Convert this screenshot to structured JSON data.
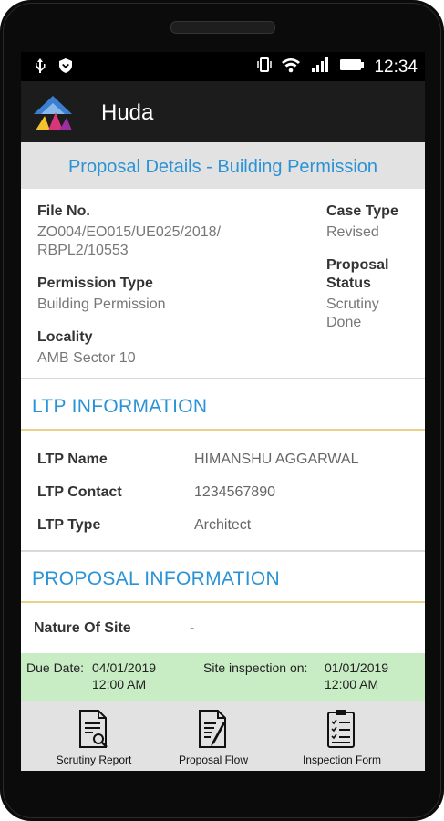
{
  "status_bar": {
    "time": "12:34"
  },
  "app": {
    "title": "Huda"
  },
  "page_title": "Proposal Details - Building Permission",
  "details": {
    "file_no_label": "File No.",
    "file_no_line1": "ZO004/EO015/UE025/2018/",
    "file_no_line2": "RBPL2/10553",
    "case_type_label": "Case Type",
    "case_type_value": "Revised",
    "permission_type_label": "Permission Type",
    "permission_type_value": "Building Permission",
    "proposal_status_label_line1": "Proposal",
    "proposal_status_label_line2": "Status",
    "proposal_status_line1": "Scrutiny",
    "proposal_status_line2": "Done",
    "locality_label": "Locality",
    "locality_value": "AMB Sector 10"
  },
  "ltp": {
    "heading": "LTP INFORMATION",
    "name_label": "LTP Name",
    "name_value": "HIMANSHU AGGARWAL",
    "contact_label": "LTP Contact",
    "contact_value": "1234567890",
    "type_label": "LTP Type",
    "type_value": "Architect"
  },
  "proposal": {
    "heading": "PROPOSAL INFORMATION",
    "nature_label": "Nature Of Site",
    "nature_value": "-"
  },
  "due_bar": {
    "due_label": "Due Date:",
    "due_date": "04/01/2019",
    "due_time": "12:00 AM",
    "site_label": "Site inspection on:",
    "site_date": "01/01/2019",
    "site_time": "12:00 AM"
  },
  "bottom_nav": {
    "scrutiny": "Scrutiny Report",
    "flow": "Proposal Flow",
    "inspection": "Inspection Form"
  }
}
